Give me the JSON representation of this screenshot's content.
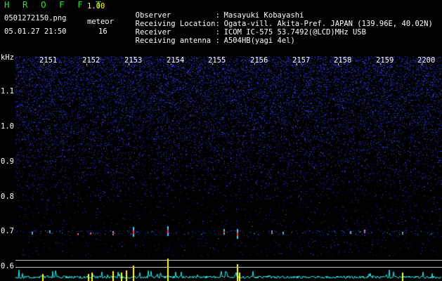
{
  "app": {
    "name": "H R O F F T",
    "version": "1.00",
    "filename": "0501272150.png",
    "datetime": "05.01.27 21:50",
    "meteor_label": "meteor",
    "meteor_count": "16"
  },
  "info": [
    {
      "key": "Observer",
      "value": "Masayuki Kobayashi"
    },
    {
      "key": "Receiving Location",
      "value": "Ogata-vill. Akita-Pref. JAPAN (139.96E, 40.02N)"
    },
    {
      "key": "Receiver",
      "value": "ICOM IC-575 53.7492(@LCD)MHz USB"
    },
    {
      "key": "Receiving antenna",
      "value": "A504HB(yagi 4el)"
    }
  ],
  "info_sep": ":",
  "axis": {
    "unit": "kHz",
    "x_ticks": [
      "2151",
      "2152",
      "2153",
      "2154",
      "2155",
      "2156",
      "2157",
      "2158",
      "2159",
      "2200"
    ],
    "y_ticks": [
      "1.1",
      "1.0",
      "0.9",
      "0.8",
      "0.7",
      "0.6"
    ]
  },
  "colors": {
    "header_green": "#1ee81e",
    "header_yellow": "#ffff33",
    "background": "#000000",
    "noise_blue": "#2a2ac8",
    "echo_red": "#ff3030",
    "trace_cyan": "#2ee8e8",
    "trace_yellow": "#ffff30"
  }
}
